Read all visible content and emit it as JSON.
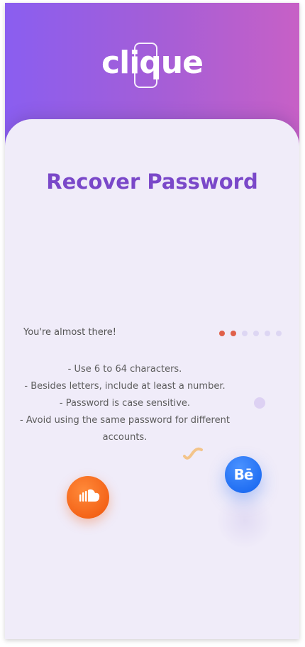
{
  "header": {
    "logo_text": "clique",
    "gradient_start": "#8a5ef0",
    "gradient_end": "#c760c6"
  },
  "main": {
    "title": "Recover Password",
    "progress_text": "You're almost there!",
    "progress": {
      "current_step": 2,
      "total_steps": 6
    },
    "rules": [
      "- Use 6 to 64 characters.",
      "- Besides letters, include at least a number.",
      "- Password is case sensitive.",
      "- Avoid using the same password for different accounts."
    ]
  },
  "icons": {
    "soundcloud": "soundcloud-icon",
    "behance": "behance-icon",
    "behance_text": "Bē"
  },
  "colors": {
    "accent": "#7a48c9",
    "step_active": "#e0604a",
    "step_inactive": "#ddd6f3",
    "soundcloud": "#f46418",
    "behance": "#1f6df2"
  }
}
